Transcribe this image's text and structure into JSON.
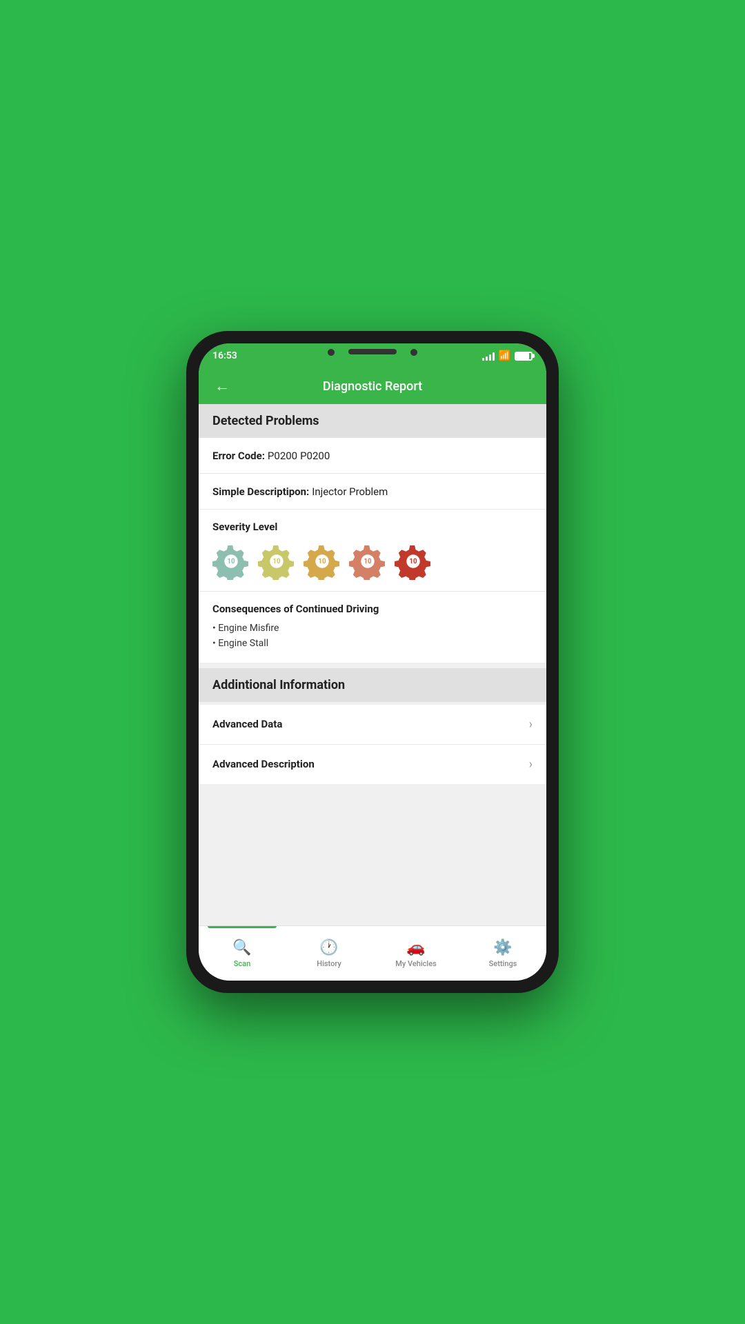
{
  "statusBar": {
    "time": "16:53"
  },
  "header": {
    "title": "Diagnostic Report",
    "backLabel": "←"
  },
  "detectedProblems": {
    "sectionTitle": "Detected Problems",
    "errorCodeLabel": "Error Code:",
    "errorCodeValue": "P0200",
    "simpleDescLabel": "Simple Descriptipon:",
    "simpleDescValue": "Injector Problem",
    "severityLabel": "Severity Level",
    "consequencesTitle": "Consequences of Continued Driving",
    "consequences": [
      "Engine Misfire",
      "Engine Stall"
    ]
  },
  "additionalInfo": {
    "sectionTitle": "Addintional Information",
    "rows": [
      {
        "label": "Advanced Data"
      },
      {
        "label": "Advanced Description"
      }
    ]
  },
  "bottomNav": {
    "items": [
      {
        "label": "Scan",
        "active": true
      },
      {
        "label": "History",
        "active": false
      },
      {
        "label": "My Vehicles",
        "active": false
      },
      {
        "label": "Settings",
        "active": false
      }
    ]
  }
}
